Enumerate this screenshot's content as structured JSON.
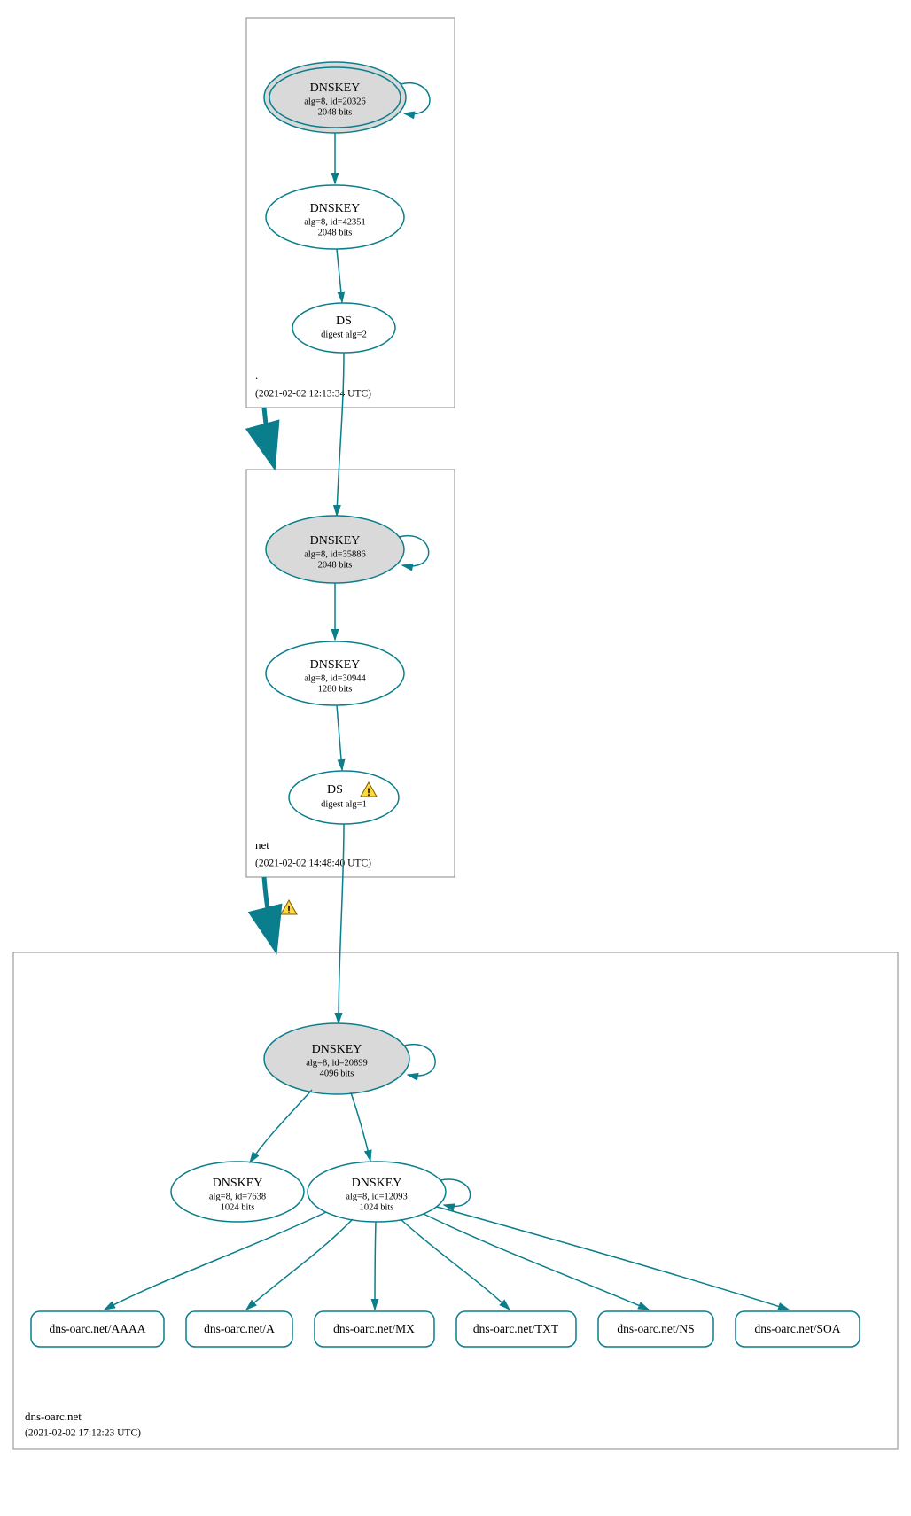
{
  "zones": [
    {
      "name": ".",
      "timestamp": "(2021-02-02 12:13:34 UTC)"
    },
    {
      "name": "net",
      "timestamp": "(2021-02-02 14:48:40 UTC)"
    },
    {
      "name": "dns-oarc.net",
      "timestamp": "(2021-02-02 17:12:23 UTC)"
    }
  ],
  "nodes": {
    "root_ksk": {
      "title": "DNSKEY",
      "l2": "alg=8, id=20326",
      "l3": "2048 bits"
    },
    "root_zsk": {
      "title": "DNSKEY",
      "l2": "alg=8, id=42351",
      "l3": "2048 bits"
    },
    "root_ds": {
      "title": "DS",
      "l2": "digest alg=2",
      "l3": ""
    },
    "net_ksk": {
      "title": "DNSKEY",
      "l2": "alg=8, id=35886",
      "l3": "2048 bits"
    },
    "net_zsk": {
      "title": "DNSKEY",
      "l2": "alg=8, id=30944",
      "l3": "1280 bits"
    },
    "net_ds": {
      "title": "DS",
      "l2": "digest alg=1",
      "l3": ""
    },
    "oarc_ksk": {
      "title": "DNSKEY",
      "l2": "alg=8, id=20899",
      "l3": "4096 bits"
    },
    "oarc_zsk_a": {
      "title": "DNSKEY",
      "l2": "alg=8, id=7638",
      "l3": "1024 bits"
    },
    "oarc_zsk_b": {
      "title": "DNSKEY",
      "l2": "alg=8, id=12093",
      "l3": "1024 bits"
    }
  },
  "rrsets": [
    "dns-oarc.net/AAAA",
    "dns-oarc.net/A",
    "dns-oarc.net/MX",
    "dns-oarc.net/TXT",
    "dns-oarc.net/NS",
    "dns-oarc.net/SOA"
  ],
  "warnings": {
    "net_ds": true,
    "delegation_to_oarc": true
  }
}
